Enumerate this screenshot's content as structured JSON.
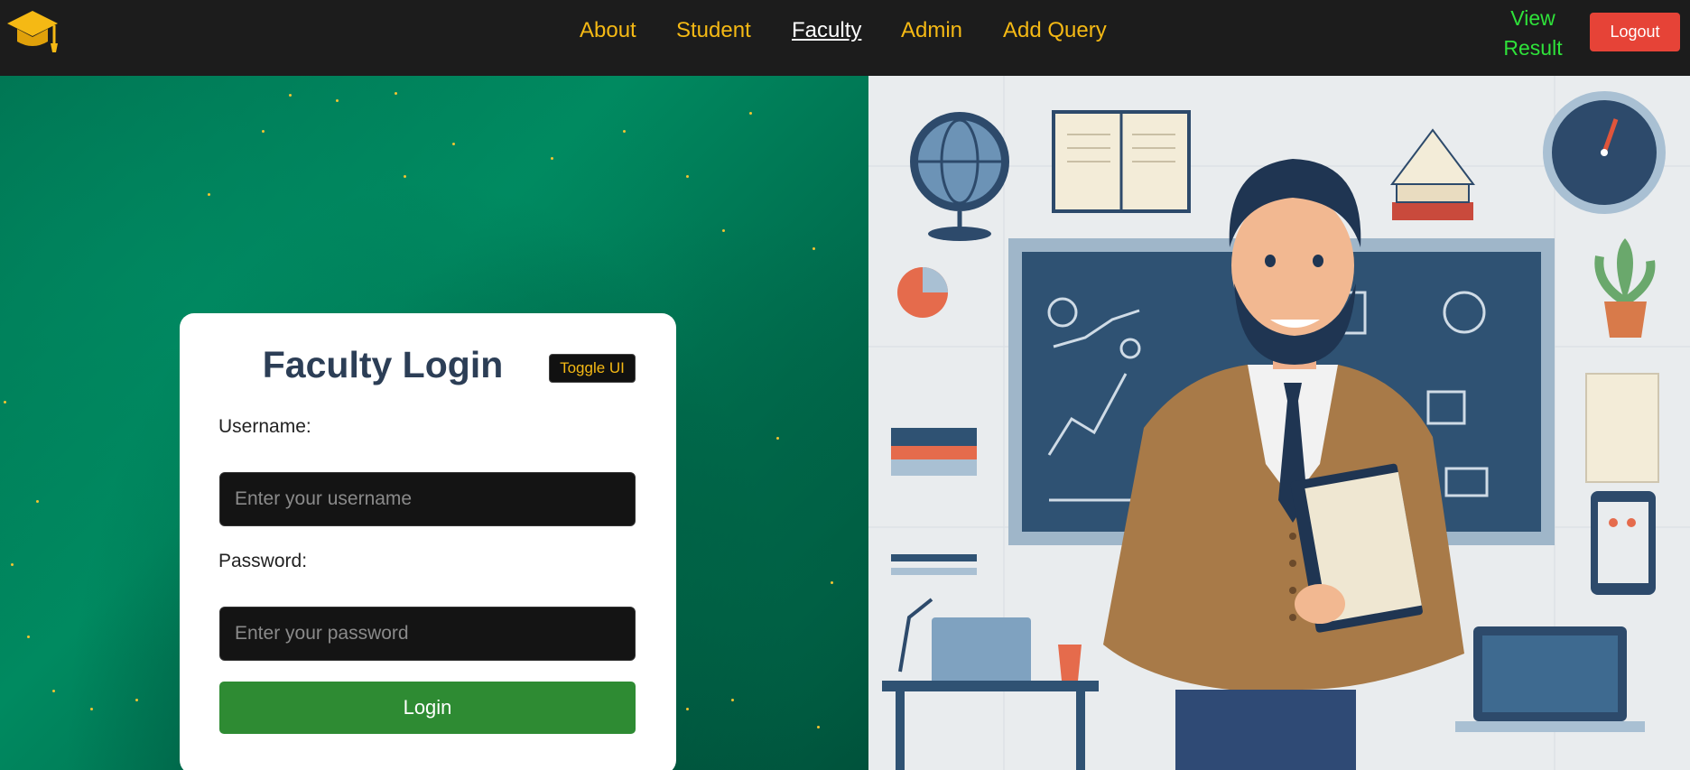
{
  "nav": {
    "links": [
      {
        "label": "About"
      },
      {
        "label": "Student"
      },
      {
        "label": "Faculty"
      },
      {
        "label": "Admin"
      },
      {
        "label": "Add Query"
      }
    ],
    "view_result_line1": "View",
    "view_result_line2": "Result",
    "logout_label": "Logout"
  },
  "login": {
    "title": "Faculty Login",
    "toggle_label": "Toggle UI",
    "username_label": "Username:",
    "username_placeholder": "Enter your username",
    "password_label": "Password:",
    "password_placeholder": "Enter your password",
    "login_button": "Login"
  },
  "colors": {
    "accent": "#f5b914",
    "login_button": "#2e8b33",
    "logout_button": "#e64337",
    "view_result": "#2fe23a",
    "navbar_bg": "#1c1c1c",
    "title_text": "#2c3e56"
  },
  "icons": {
    "logo": "graduation-cap-icon"
  }
}
